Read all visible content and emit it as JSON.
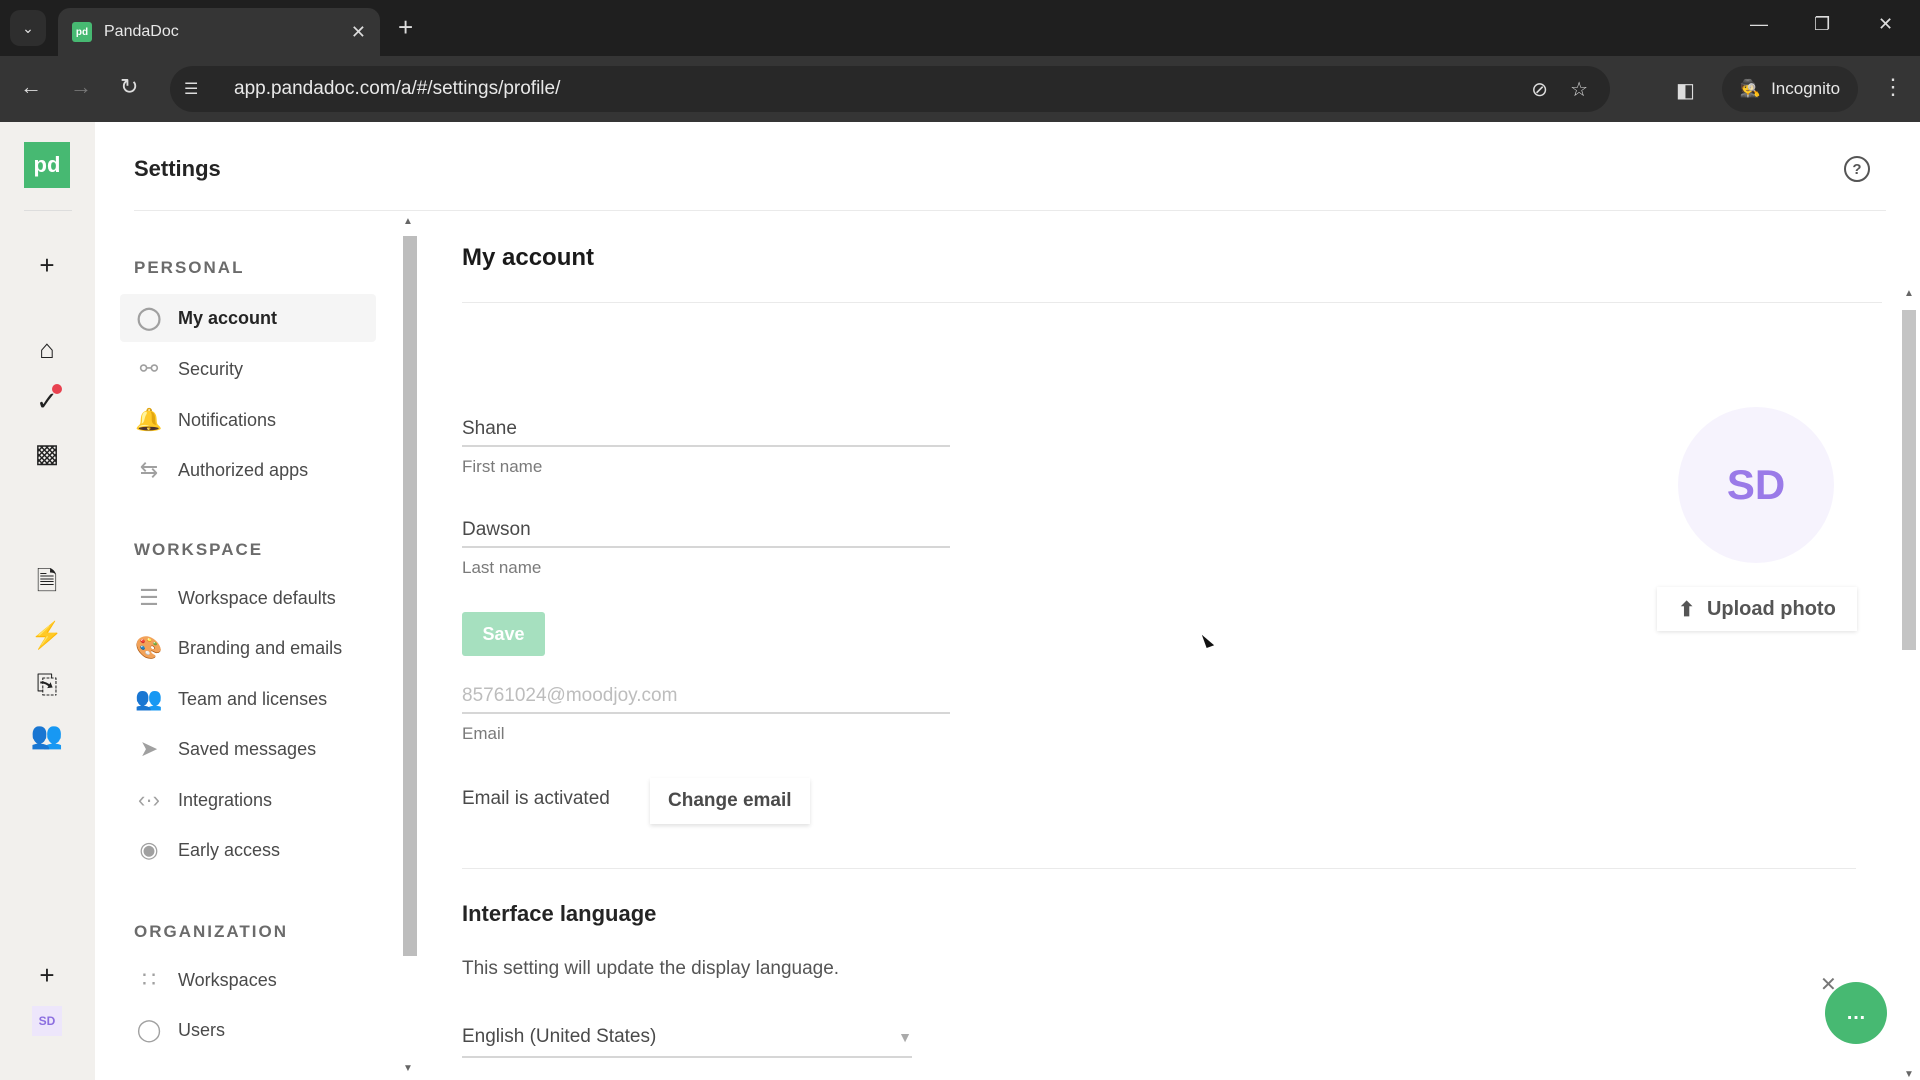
{
  "browser": {
    "tab_title": "PandaDoc",
    "favicon_text": "pd",
    "url": "app.pandadoc.com/a/#/settings/profile/",
    "incognito_label": "Incognito"
  },
  "rail": {
    "logo_text": "pd",
    "avatar_initials": "SD",
    "icons": [
      "plus-icon",
      "home-icon",
      "tasks-icon",
      "reports-icon",
      "document-icon",
      "automation-icon",
      "templates-icon",
      "contacts-icon",
      "invite-user-icon"
    ]
  },
  "header": {
    "title": "Settings"
  },
  "nav": {
    "sections": [
      {
        "title": "PERSONAL",
        "items": [
          {
            "label": "My account",
            "icon": "user-circle-icon",
            "active": true
          },
          {
            "label": "Security",
            "icon": "key-icon"
          },
          {
            "label": "Notifications",
            "icon": "bell-icon"
          },
          {
            "label": "Authorized apps",
            "icon": "swap-arrows-icon"
          }
        ]
      },
      {
        "title": "WORKSPACE",
        "items": [
          {
            "label": "Workspace defaults",
            "icon": "sliders-icon"
          },
          {
            "label": "Branding and emails",
            "icon": "palette-icon"
          },
          {
            "label": "Team and licenses",
            "icon": "team-icon"
          },
          {
            "label": "Saved messages",
            "icon": "send-icon"
          },
          {
            "label": "Integrations",
            "icon": "code-icon"
          },
          {
            "label": "Early access",
            "icon": "eye-icon"
          }
        ]
      },
      {
        "title": "ORGANIZATION",
        "items": [
          {
            "label": "Workspaces",
            "icon": "grid-dots-icon"
          },
          {
            "label": "Users",
            "icon": "user-circle-icon"
          }
        ]
      }
    ]
  },
  "account": {
    "title": "My account",
    "first_name": {
      "value": "Shane",
      "label": "First name"
    },
    "last_name": {
      "value": "Dawson",
      "label": "Last name"
    },
    "save_label": "Save",
    "email": {
      "value": "85761024@moodjoy.com",
      "label": "Email"
    },
    "email_status": "Email is activated",
    "change_email_label": "Change email",
    "avatar_initials": "SD",
    "upload_photo_label": "Upload photo"
  },
  "language": {
    "title": "Interface language",
    "description": "This setting will update the display language.",
    "selected": "English (United States)"
  },
  "colors": {
    "brand": "#47b972",
    "avatar": "#9a7ae8",
    "save_disabled": "#a6e0bf"
  }
}
